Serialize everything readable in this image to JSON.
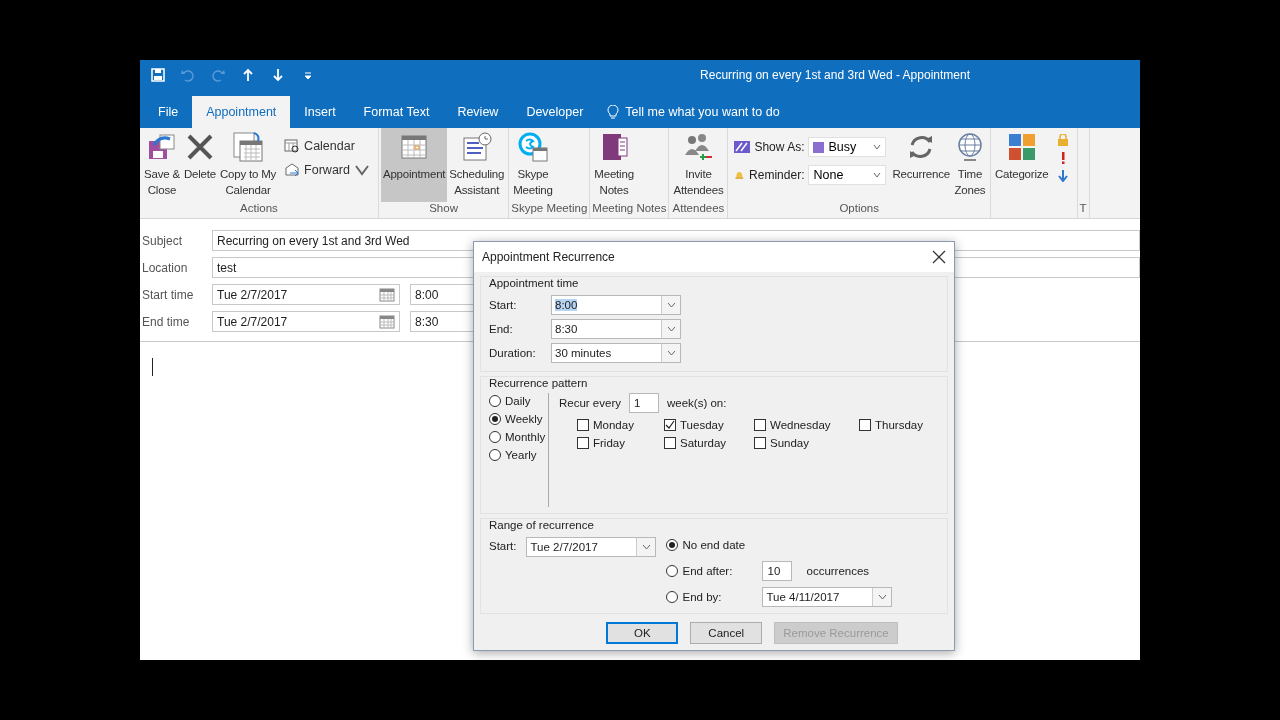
{
  "window": {
    "title": "Recurring on every 1st and 3rd Wed  -  Appointment"
  },
  "menu_tabs": [
    {
      "label": "File",
      "selected": false
    },
    {
      "label": "Appointment",
      "selected": true
    },
    {
      "label": "Insert",
      "selected": false
    },
    {
      "label": "Format Text",
      "selected": false
    },
    {
      "label": "Review",
      "selected": false
    },
    {
      "label": "Developer",
      "selected": false
    }
  ],
  "tell_me": "Tell me what you want to do",
  "ribbon": {
    "groups": [
      {
        "label": "Actions",
        "items": [
          {
            "kind": "large",
            "label": "Save &\nClose",
            "selected": false
          },
          {
            "kind": "large",
            "label": "Delete",
            "selected": false
          },
          {
            "kind": "large",
            "label": "Copy to My\nCalendar",
            "selected": false
          },
          {
            "kind": "small_stack",
            "entries": [
              {
                "label": "Calendar",
                "dropdown": false
              },
              {
                "label": "Forward",
                "dropdown": true
              }
            ]
          }
        ]
      },
      {
        "label": "Show",
        "items": [
          {
            "kind": "large",
            "label": "Appointment",
            "selected": true
          },
          {
            "kind": "large",
            "label": "Scheduling\nAssistant",
            "selected": false
          }
        ]
      },
      {
        "label": "Skype Meeting",
        "items": [
          {
            "kind": "large",
            "label": "Skype\nMeeting",
            "selected": false
          }
        ]
      },
      {
        "label": "Meeting Notes",
        "items": [
          {
            "kind": "large",
            "label": "Meeting\nNotes",
            "selected": false
          }
        ]
      },
      {
        "label": "Attendees",
        "items": [
          {
            "kind": "large",
            "label": "Invite\nAttendees",
            "selected": false
          }
        ]
      },
      {
        "label": "Options",
        "items": [
          {
            "kind": "option_rows",
            "rows": [
              {
                "label": "Show As:",
                "value": "Busy"
              },
              {
                "label": "Reminder:",
                "value": "None"
              }
            ]
          },
          {
            "kind": "large",
            "label": "Recurrence",
            "selected": false
          },
          {
            "kind": "large",
            "label": "Time\nZones",
            "selected": false
          }
        ]
      },
      {
        "items": [
          {
            "kind": "large",
            "label": "Categorize",
            "selected": false
          },
          {
            "kind": "icon_stack"
          }
        ]
      },
      {
        "label": "T"
      }
    ]
  },
  "form": {
    "rows": [
      {
        "kind": "text",
        "label": "Subject",
        "value": "Recurring on every 1st and 3rd Wed"
      },
      {
        "kind": "text",
        "label": "Location",
        "value": "test"
      },
      {
        "kind": "datetime",
        "label": "Start time",
        "date": "Tue 2/7/2017",
        "time": "8:00"
      },
      {
        "kind": "datetime",
        "label": "End time",
        "date": "Tue 2/7/2017",
        "time": "8:30"
      }
    ]
  },
  "dialog": {
    "title": "Appointment Recurrence",
    "appointment_time": {
      "label": "Appointment time",
      "fields": [
        {
          "label": "Start:",
          "value": "8:00",
          "selected": true
        },
        {
          "label": "End:",
          "value": "8:30",
          "selected": false
        },
        {
          "label": "Duration:",
          "value": "30 minutes",
          "selected": false
        }
      ]
    },
    "pattern": {
      "label": "Recurrence pattern",
      "options": [
        {
          "label": "Daily",
          "selected": false
        },
        {
          "label": "Weekly",
          "selected": true
        },
        {
          "label": "Monthly",
          "selected": false
        },
        {
          "label": "Yearly",
          "selected": false
        }
      ],
      "recur_label": "Recur every",
      "interval": "1",
      "interval_suffix": "week(s) on:",
      "days": [
        {
          "label": "Monday",
          "checked": false
        },
        {
          "label": "Tuesday",
          "checked": true
        },
        {
          "label": "Wednesday",
          "checked": false
        },
        {
          "label": "Thursday",
          "checked": false
        },
        {
          "label": "Friday",
          "checked": false
        },
        {
          "label": "Saturday",
          "checked": false
        },
        {
          "label": "Sunday",
          "checked": false
        }
      ]
    },
    "range": {
      "label": "Range of recurrence",
      "start_label": "Start:",
      "start_value": "Tue 2/7/2017",
      "end_options": [
        {
          "kind": "none",
          "label": "No end date",
          "selected": true
        },
        {
          "kind": "after",
          "label": "End after:",
          "value": "10",
          "suffix": "occurrences",
          "selected": false
        },
        {
          "kind": "by",
          "label": "End by:",
          "value": "Tue 4/11/2017",
          "selected": false
        }
      ]
    },
    "buttons": [
      {
        "label": "OK",
        "default": true,
        "disabled": false
      },
      {
        "label": "Cancel",
        "default": false,
        "disabled": false
      },
      {
        "label": "Remove Recurrence",
        "default": false,
        "disabled": true
      }
    ]
  }
}
